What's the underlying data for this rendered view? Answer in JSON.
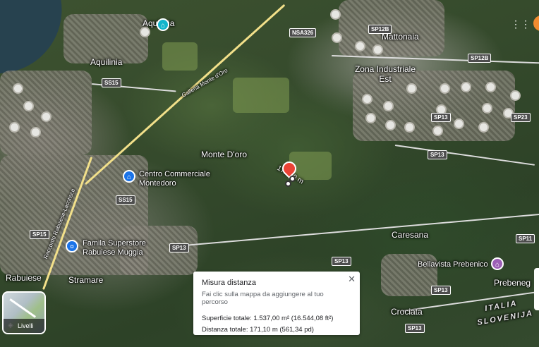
{
  "map": {
    "place_labels": {
      "aquilinia_top": "Aquilinia",
      "aquilinia": "Aquilinia",
      "mattonaia": "Mattonaia",
      "zona_industriale": "Zona Industriale Est",
      "monte_doro": "Monte D'oro",
      "centro_commerciale": "Centro Commerciale Montedoro",
      "famila": "Famila Superstore Rabuiese Muggia",
      "caresana": "Caresana",
      "bellavista": "Bellavista Prebenico",
      "prebeneg": "Prebeneg",
      "rabuiese": "Rabuiese",
      "stramare": "Stramare",
      "crociata": "Crociata",
      "italia": "ITALIA",
      "slovenija": "SLOVENIJA",
      "galleria": "Galleria Monte d'Oro",
      "raccordo": "Raccordo Rabuiese-Lacotisce",
      "distance_on_map": "171,10 m"
    },
    "road_shields": {
      "nsa326": "NSA326",
      "sp12b_1": "SP12B",
      "sp12b_2": "SP12B",
      "ss15_1": "SS15",
      "ss15_2": "SS15",
      "sp13_1": "SP13",
      "sp13_2": "SP13",
      "sp13_3": "SP13",
      "sp13_4": "SP13",
      "sp13_5": "SP13",
      "sp13_6": "SP13",
      "sp23": "SP23",
      "sp15": "SP15",
      "sp11": "SP11"
    },
    "icons": {
      "shopping": "shopping-bag-icon",
      "cart": "shopping-cart-icon",
      "lodging": "house-icon",
      "apps": "grid-icon",
      "layers": "layers-icon",
      "close": "close-icon"
    }
  },
  "layers_button": {
    "label": "Livelli"
  },
  "measure_panel": {
    "title": "Misura distanza",
    "subtitle": "Fai clic sulla mappa da aggiungere al tuo percorso",
    "area": "Superficie totale: 1.537,00 m² (16.544,08 ft²)",
    "distance": "Distanza totale: 171,10 m (561,34 pd)",
    "close_glyph": "✕"
  },
  "colors": {
    "pin": "#ea4335",
    "accent": "#1a73e8"
  }
}
